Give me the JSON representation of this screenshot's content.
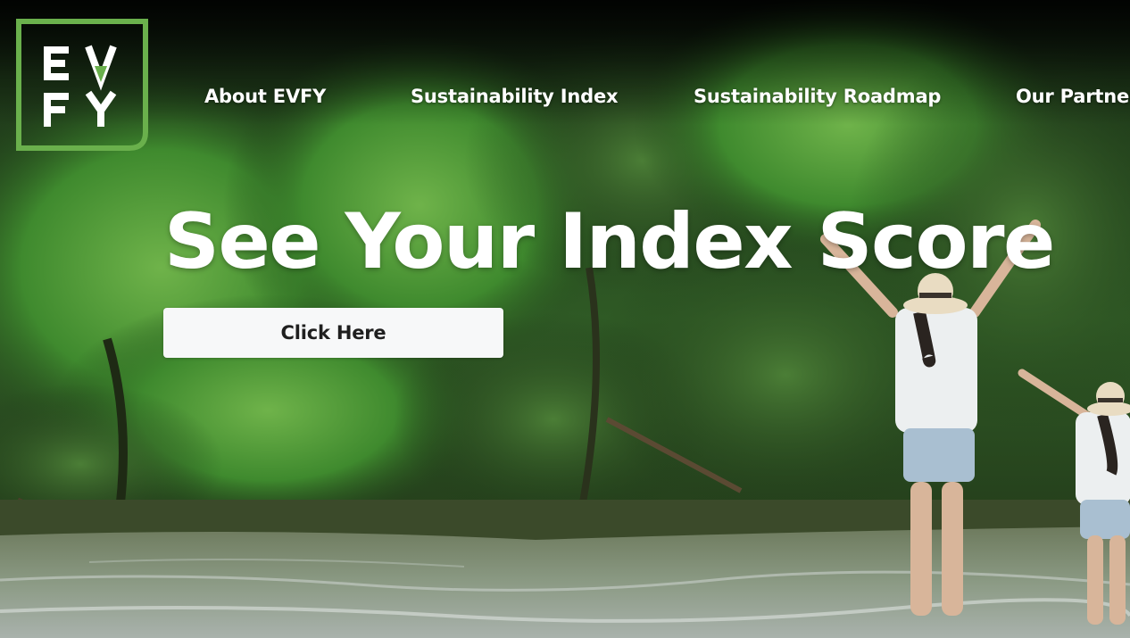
{
  "brand": {
    "logo_text_top": "EV",
    "logo_text_bottom": "FY",
    "logo_color": "#6ab04c",
    "logo_text_color": "#ffffff"
  },
  "nav": {
    "items": [
      {
        "label": "About EVFY"
      },
      {
        "label": "Sustainability Index"
      },
      {
        "label": "Sustainability Roadmap"
      },
      {
        "label": "Our Partners"
      }
    ]
  },
  "hero": {
    "headline": "See Your Index Score",
    "cta_label": "Click Here",
    "background_image": "forest-river-photo"
  },
  "colors": {
    "button_bg": "#f7f8f9",
    "button_text": "#1f1f1f",
    "text_white": "#ffffff"
  }
}
